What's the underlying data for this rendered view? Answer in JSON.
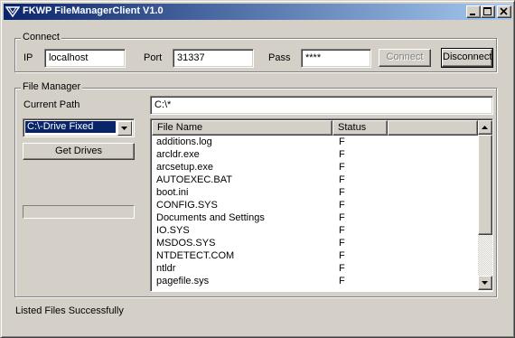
{
  "window": {
    "title": "FKWP FileManagerClient V1.0",
    "icons": {
      "app": "app-icon",
      "minimize": "minimize-icon",
      "maximize": "maximize-icon",
      "close": "close-icon"
    }
  },
  "connect": {
    "group_label": "Connect",
    "ip_label": "IP",
    "ip_value": "localhost",
    "port_label": "Port",
    "port_value": "31337",
    "pass_label": "Pass",
    "pass_value": "****",
    "connect_button": "Connect",
    "connect_enabled": false,
    "disconnect_button": "Disconnect"
  },
  "file_manager": {
    "group_label": "File Manager",
    "current_path_label": "Current Path",
    "current_path_value": "C:\\*",
    "drive_selected": "C:\\-Drive Fixed",
    "get_drives_button": "Get Drives",
    "columns": [
      "File Name",
      "Status"
    ],
    "files": [
      {
        "name": "additions.log",
        "status": "F"
      },
      {
        "name": "arcldr.exe",
        "status": "F"
      },
      {
        "name": "arcsetup.exe",
        "status": "F"
      },
      {
        "name": "AUTOEXEC.BAT",
        "status": "F"
      },
      {
        "name": "boot.ini",
        "status": "F"
      },
      {
        "name": "CONFIG.SYS",
        "status": "F"
      },
      {
        "name": "Documents and Settings",
        "status": "F"
      },
      {
        "name": "IO.SYS",
        "status": "F"
      },
      {
        "name": "MSDOS.SYS",
        "status": "F"
      },
      {
        "name": "NTDETECT.COM",
        "status": "F"
      },
      {
        "name": "ntldr",
        "status": "F"
      },
      {
        "name": "pagefile.sys",
        "status": "F"
      }
    ]
  },
  "status_text": "Listed Files Successfully",
  "colors": {
    "titlebar_start": "#0a246a",
    "titlebar_end": "#a6caf0",
    "face": "#d4d0c8",
    "selection": "#0a246a"
  }
}
